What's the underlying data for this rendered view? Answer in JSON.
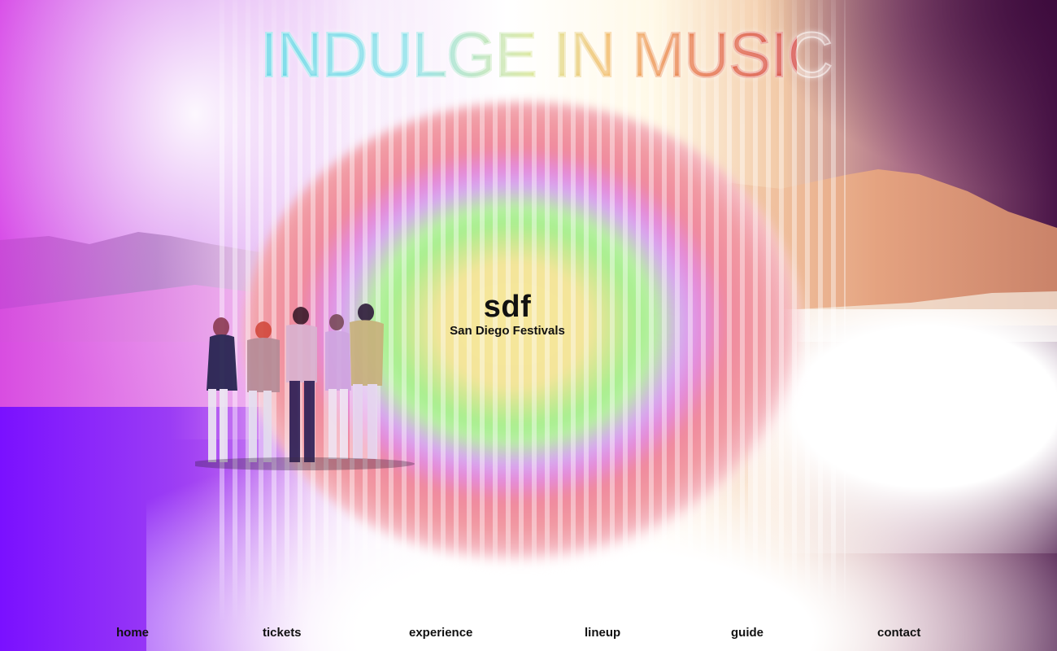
{
  "hero": {
    "title": "INDULGE IN MUSIC",
    "logo_mark": "sdf",
    "logo_subtitle": "San Diego Festivals"
  },
  "nav": {
    "items": [
      {
        "label": "home"
      },
      {
        "label": "tickets"
      },
      {
        "label": "experience"
      },
      {
        "label": "lineup"
      },
      {
        "label": "guide"
      },
      {
        "label": "contact"
      }
    ]
  },
  "colors": {
    "title_gradient_start": "#39c9de",
    "title_gradient_end": "#c91712",
    "purple": "#7a10ff",
    "ring_center": "#f6e79b",
    "ring_green": "#a7ef8f",
    "ring_pink": "#f08a9d",
    "text": "#111111"
  },
  "icons": {
    "background": "festival-crowd-mountains-photo"
  }
}
